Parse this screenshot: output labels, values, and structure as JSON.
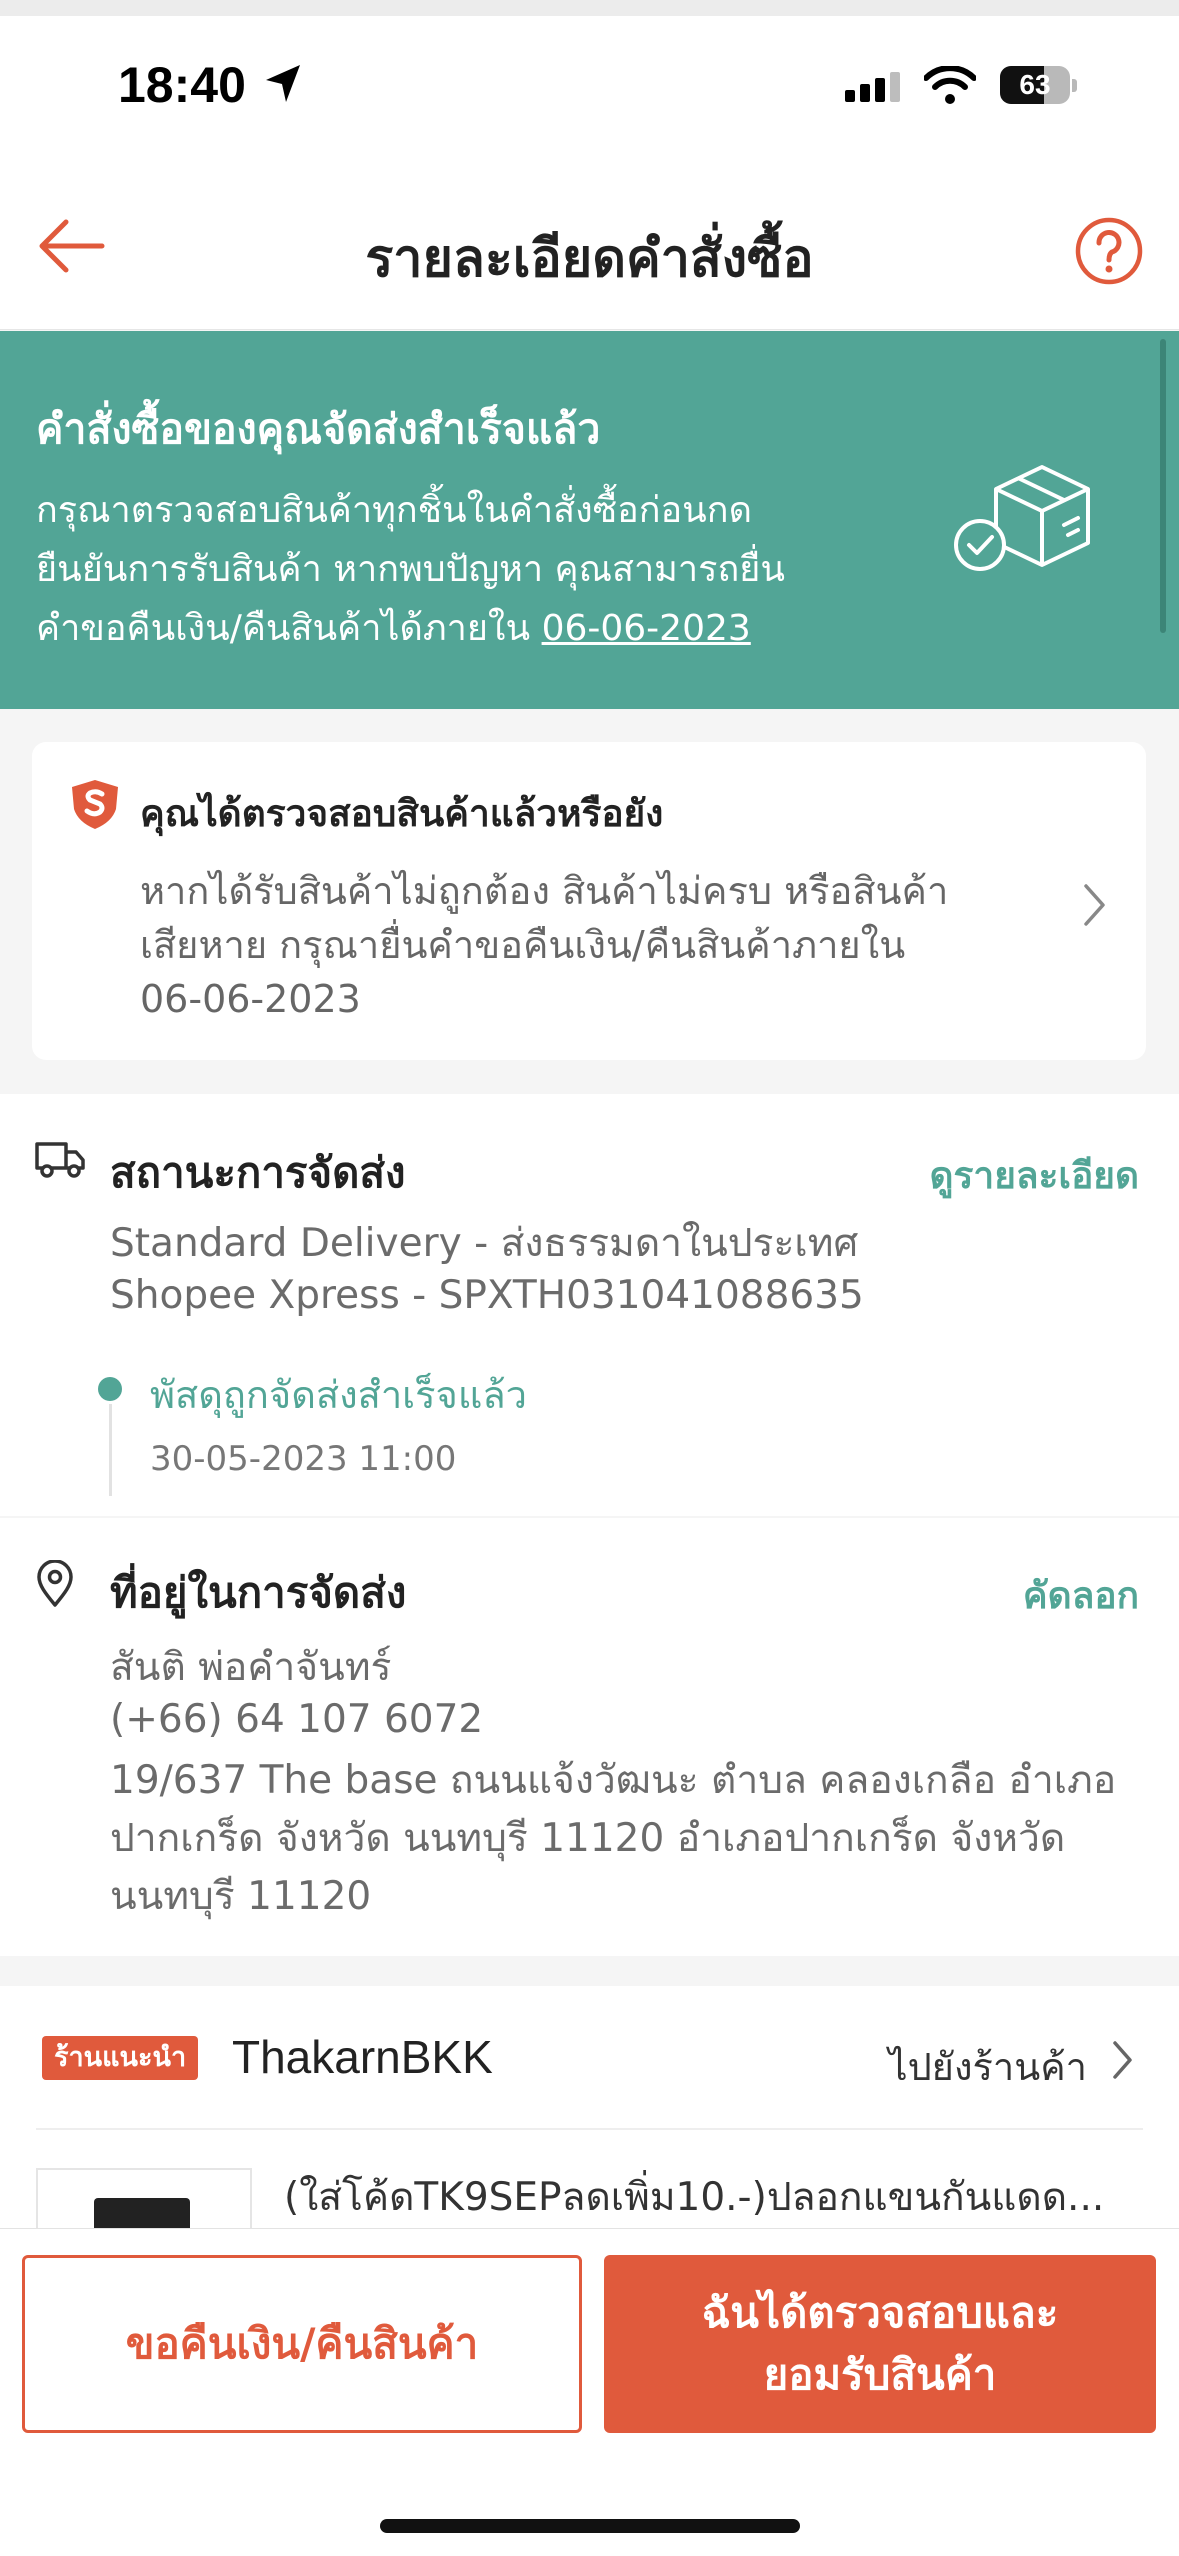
{
  "status_bar": {
    "time": "18:40",
    "battery": "63",
    "battery_level": 0.63
  },
  "nav": {
    "title": "รายละเอียดคำสั่งซื้อ"
  },
  "banner": {
    "title": "คำสั่งซื้อของคุณจัดส่งสำเร็จแล้ว",
    "line1": "กรุณาตรวจสอบสินค้าทุกชิ้นในคำสั่งซื้อก่อนกด",
    "line2": "ยืนยันการรับสินค้า หากพบปัญหา คุณสามารถยื่น",
    "line3_prefix": "คำขอคืนเงิน/คืนสินค้าได้ภายใน ",
    "deadline": "06-06-2023"
  },
  "inspect_card": {
    "title": "คุณได้ตรวจสอบสินค้าแล้วหรือยัง",
    "line1": "หากได้รับสินค้าไม่ถูกต้อง สินค้าไม่ครบ หรือสินค้า",
    "line2": "เสียหาย กรุณายื่นคำขอคืนเงิน/คืนสินค้าภายใน",
    "line3": "06-06-2023"
  },
  "shipping": {
    "title": "สถานะการจัดส่ง",
    "link": "ดูรายละเอียด",
    "method": "Standard Delivery - ส่งธรรมดาในประเทศ",
    "carrier": "Shopee Xpress - SPXTH031041088635",
    "status": "พัสดุถูกจัดส่งสำเร็จแล้ว",
    "status_time": "30-05-2023 11:00"
  },
  "address": {
    "title": "ที่อยู่ในการจัดส่ง",
    "link": "คัดลอก",
    "name": "สันติ พ่อคำจันทร์",
    "phone": "(+66) 64 107 6072",
    "line1": "19/637 The base ถนนแจ้งวัฒนะ ตำบล คลองเกลือ อำเภอ",
    "line2": "ปากเกร็ด จังหวัด นนทบุรี 11120 อำเภอปากเกร็ด จังหวัด",
    "line3": "นนทบุรี 11120"
  },
  "shop": {
    "badge": "ร้านแนะนำ",
    "name": "ThakarnBKK",
    "goto": "ไปยังร้านค้า",
    "product_name": "(ใส่โค้ดTK9SEPลดเพิ่ม10.-)ปลอกแขนกันแดด..."
  },
  "actions": {
    "refund_label": "ขอคืนเงิน/คืนสินค้า",
    "accept_label": "ฉันได้ตรวจสอบและ\nยอมรับสินค้า"
  },
  "colors": {
    "accent": "#e05a3c",
    "green": "#52a596"
  }
}
